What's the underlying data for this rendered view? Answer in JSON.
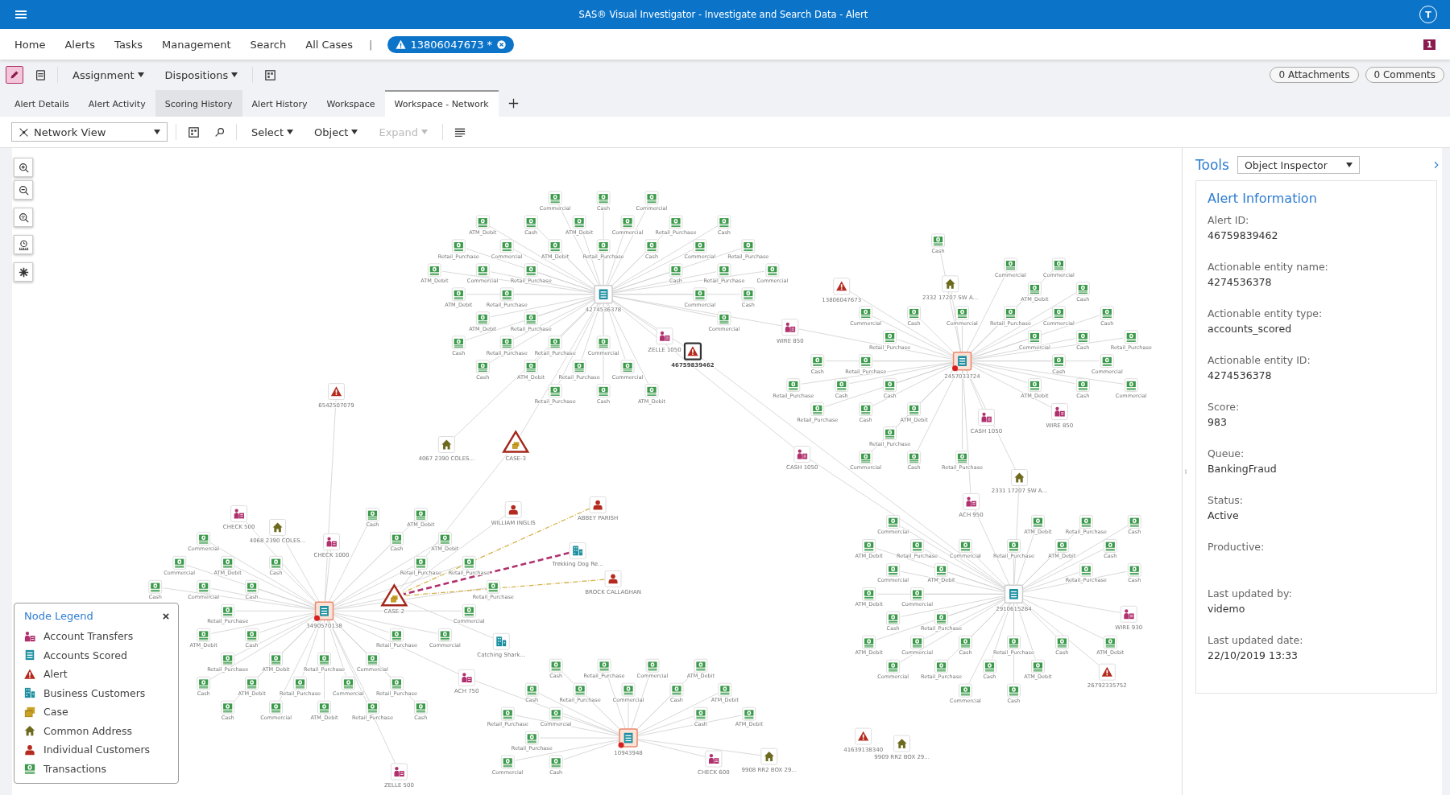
{
  "app_bar": {
    "title": "SAS® Visual Investigator - Investigate and Search Data - Alert",
    "user_initial": "T"
  },
  "nav": {
    "items": [
      "Home",
      "Alerts",
      "Tasks",
      "Management",
      "Search",
      "All Cases"
    ],
    "separator": "|",
    "open_item": "13806047673 *",
    "badge": "1"
  },
  "toolbar": {
    "edit_selected": true,
    "menus": [
      "Assignment",
      "Dispositions"
    ],
    "counters": [
      "0 Attachments",
      "0 Comments"
    ]
  },
  "tabs": [
    {
      "label": "Alert Details",
      "selected": false,
      "hovered": false
    },
    {
      "label": "Alert Activity",
      "selected": false,
      "hovered": false
    },
    {
      "label": "Scoring History",
      "selected": false,
      "hovered": true
    },
    {
      "label": "Alert History",
      "selected": false,
      "hovered": false
    },
    {
      "label": "Workspace",
      "selected": false,
      "hovered": false
    },
    {
      "label": "Workspace - Network",
      "selected": true,
      "hovered": false
    }
  ],
  "network_toolbar": {
    "view": "Network View",
    "menus": [
      {
        "label": "Select",
        "disabled": false
      },
      {
        "label": "Object",
        "disabled": false
      },
      {
        "label": "Expand",
        "disabled": true
      }
    ]
  },
  "graph": {
    "hubs": [
      {
        "label": "4274536378",
        "flagged": false,
        "satellites": [
          "Commercial",
          "Cash",
          "Commercial",
          "ATM_Debit",
          "Cash",
          "ATM_Debit",
          "Commercial",
          "Retail_Purchase",
          "Cash",
          "Retail_Purchase",
          "Commercial",
          "ATM_Debit",
          "Retail_Purchase",
          "Cash",
          "Commercial",
          "Retail_Purchase",
          "ATM_Debit",
          "Commercial",
          "Retail_Purchase",
          "Cash",
          "Retail_Purchase",
          "Commercial",
          "ATM_Debit",
          "Retail_Purchase",
          "Commercial",
          "Cash",
          "ATM_Debit",
          "Retail_Purchase",
          "Commercial",
          "Cash",
          "Retail_Purchase",
          "Retail_Purchase",
          "Commercial",
          "Cash",
          "ATM_Debit",
          "Retail_Purchase",
          "Commercial",
          "Retail_Purchase",
          "Cash",
          "ATM_Debit"
        ]
      },
      {
        "label": "2457033724",
        "flagged": true,
        "satellites": [
          "Cash",
          "Commercial",
          "Commercial",
          "ATM_Debit",
          "Cash",
          "Commercial",
          "Cash",
          "Commercial",
          "Retail_Purchase",
          "Commercial",
          "Cash",
          "Retail_Purchase",
          "Commercial",
          "Cash",
          "Retail_Purchase",
          "Cash",
          "Retail_Purchase",
          "Cash",
          "Commercial",
          "Retail_Purchase",
          "Cash",
          "Cash",
          "ATM_Debit",
          "Cash",
          "Commercial",
          "Retail_Purchase",
          "Cash",
          "ATM_Debit",
          "Retail_Purchase",
          "Commercial",
          "Cash",
          "Retail_Purchase"
        ]
      },
      {
        "label": "3490570138",
        "flagged": true,
        "satellites": [
          "Cash",
          "ATM_Debit",
          "Commercial",
          "Cash",
          "ATM_Debit",
          "Commercial",
          "ATM_Debit",
          "Cash",
          "Retail_Purchase",
          "Retail_Purchase",
          "Cash",
          "Commercial",
          "Cash",
          "Retail_Purchase",
          "Retail_Purchase",
          "Commercial",
          "ATM_Debit",
          "Cash",
          "Retail_Purchase",
          "Commercial",
          "Retail_Purchase",
          "ATM_Debit",
          "Retail_Purchase",
          "Commercial",
          "Cash",
          "ATM_Debit",
          "Retail_Purchase",
          "Commercial",
          "Retail_Purchase",
          "Cash",
          "Commercial",
          "ATM_Debit",
          "Retail_Purchase",
          "Cash"
        ]
      },
      {
        "label": "2910615284",
        "flagged": false,
        "satellites": [
          "Commercial",
          "ATM_Debit",
          "Retail_Purchase",
          "Cash",
          "ATM_Debit",
          "Retail_Purchase",
          "Commercial",
          "Retail_Purchase",
          "ATM_Debit",
          "Cash",
          "Commercial",
          "ATM_Debit",
          "Retail_Purchase",
          "Cash",
          "ATM_Debit",
          "Commercial",
          "Cash",
          "Retail_Purchase",
          "ATM_Debit",
          "Commercial",
          "Cash",
          "Retail_Purchase",
          "Cash",
          "ATM_Debit",
          "Commercial",
          "Retail_Purchase",
          "Cash",
          "ATM_Debit",
          "Commercial",
          "Cash"
        ]
      },
      {
        "label": "10943948",
        "flagged": true,
        "satellites": [
          "Cash",
          "Retail_Purchase",
          "Commercial",
          "ATM_Debit",
          "Cash",
          "Retail_Purchase",
          "Commercial",
          "Cash",
          "ATM_Debit",
          "Retail_Purchase",
          "Commercial",
          "Cash",
          "ATM_Debit",
          "Retail_Purchase",
          "Commercial",
          "Cash"
        ]
      }
    ],
    "nodes": [
      {
        "kind": "alert",
        "label": "46759839462",
        "selected": true
      },
      {
        "kind": "alert",
        "label": "13806047673",
        "selected": false
      },
      {
        "kind": "transfer",
        "label": "WIRE 850",
        "selected": false
      },
      {
        "kind": "transfer",
        "label": "ZELLE 1050",
        "selected": false
      },
      {
        "kind": "alert",
        "label": "6542507079",
        "selected": false
      },
      {
        "kind": "address",
        "label": "4067 2390 COLES...",
        "selected": false
      },
      {
        "kind": "case",
        "label": "CASE-3",
        "selected": false
      },
      {
        "kind": "transfer",
        "label": "CASH 1050",
        "selected": false
      },
      {
        "kind": "address",
        "label": "2332 17207 SW A...",
        "selected": false
      },
      {
        "kind": "transfer",
        "label": "CASH 1050",
        "selected": false
      },
      {
        "kind": "transfer",
        "label": "WIRE 850",
        "selected": false
      },
      {
        "kind": "address",
        "label": "2331 17207 SW A...",
        "selected": false
      },
      {
        "kind": "transfer",
        "label": "ACH 950",
        "selected": false
      },
      {
        "kind": "transfer",
        "label": "CHECK 500",
        "selected": false
      },
      {
        "kind": "address",
        "label": "4068 2390 COLES...",
        "selected": false
      },
      {
        "kind": "transfer",
        "label": "CHECK 1000",
        "selected": false
      },
      {
        "kind": "individual",
        "label": "WILLIAM INGLIS",
        "selected": false
      },
      {
        "kind": "individual",
        "label": "ABBEY PARISH",
        "selected": false
      },
      {
        "kind": "business",
        "label": "Trekking Dog Re...",
        "selected": false
      },
      {
        "kind": "case",
        "label": "CASE-2",
        "selected": false
      },
      {
        "kind": "individual",
        "label": "BROCK CALLAGHAN",
        "selected": false
      },
      {
        "kind": "transfer",
        "label": "WIRE 930",
        "selected": false
      },
      {
        "kind": "business",
        "label": "Catching Shark...",
        "selected": false
      },
      {
        "kind": "alert",
        "label": "26792335752",
        "selected": false
      },
      {
        "kind": "transfer",
        "label": "ACH 750",
        "selected": false
      },
      {
        "kind": "transfer",
        "label": "CHECK 600",
        "selected": false
      },
      {
        "kind": "address",
        "label": "9908 RR2 BOX 29...",
        "selected": false
      },
      {
        "kind": "alert",
        "label": "41639138340",
        "selected": false
      },
      {
        "kind": "address",
        "label": "9909 RR2 BOX 29...",
        "selected": false
      },
      {
        "kind": "transfer",
        "label": "ZELLE 500",
        "selected": false
      }
    ]
  },
  "legend": {
    "title": "Node Legend",
    "items": [
      {
        "kind": "transfer",
        "label": "Account Transfers"
      },
      {
        "kind": "scored",
        "label": "Accounts Scored"
      },
      {
        "kind": "alert",
        "label": "Alert"
      },
      {
        "kind": "business",
        "label": "Business Customers"
      },
      {
        "kind": "case",
        "label": "Case"
      },
      {
        "kind": "address",
        "label": "Common Address"
      },
      {
        "kind": "individual",
        "label": "Individual Customers"
      },
      {
        "kind": "transaction",
        "label": "Transactions"
      }
    ]
  },
  "tools": {
    "title": "Tools",
    "inspector": "Object Inspector",
    "card_title": "Alert Information",
    "fields": [
      {
        "label": "Alert ID:",
        "value": "46759839462"
      },
      {
        "label": "Actionable entity name:",
        "value": "4274536378"
      },
      {
        "label": "Actionable entity type:",
        "value": "accounts_scored"
      },
      {
        "label": "Actionable entity ID:",
        "value": "4274536378"
      },
      {
        "label": "Score:",
        "value": "983"
      },
      {
        "label": "Queue:",
        "value": "BankingFraud"
      },
      {
        "label": "Status:",
        "value": "Active"
      },
      {
        "label": "Productive:"
      },
      {
        "label": "Last updated by:",
        "value": "videmo"
      },
      {
        "label": "Last updated date:",
        "value": "22/10/2019 13:33"
      }
    ]
  }
}
